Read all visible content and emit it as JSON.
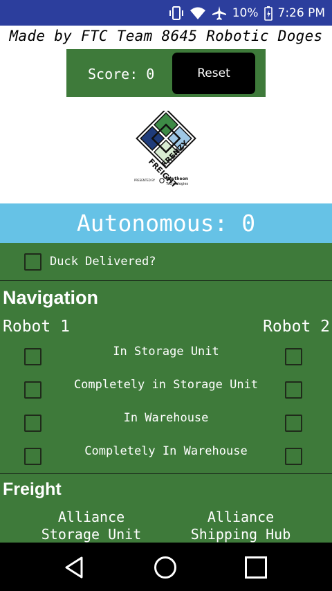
{
  "status_bar": {
    "battery_percent": "10%",
    "time": "7:26 PM",
    "icons": [
      "vibrate-icon",
      "wifi-icon",
      "airplane-icon",
      "battery-icon"
    ]
  },
  "credit": "Made by FTC Team 8645 Robotic Doges",
  "score": {
    "label": "Score: 0",
    "reset_label": "Reset"
  },
  "logo": {
    "name": "freight-frenzy-logo",
    "text_1": "FREIGHT",
    "text_2": "FRENZY",
    "presented_by": "PRESENTED BY",
    "sponsor": "Raytheon",
    "sponsor_sub": "Technologies"
  },
  "autonomous": {
    "title": "Autonomous: 0",
    "duck_label": "Duck Delivered?"
  },
  "navigation": {
    "title": "Navigation",
    "robot1": "Robot 1",
    "robot2": "Robot 2",
    "rows": [
      "In Storage Unit",
      "Completely in Storage Unit",
      "In Warehouse",
      "Completely In Warehouse"
    ]
  },
  "freight": {
    "title": "Freight",
    "col1_line1": "Alliance",
    "col1_line2": "Storage Unit",
    "col2_line1": "Alliance",
    "col2_line2": "Shipping Hub"
  },
  "colors": {
    "status_bar": "#2c3e9d",
    "header_blue": "#66c2e6",
    "panel_green": "#3e7a3a"
  }
}
